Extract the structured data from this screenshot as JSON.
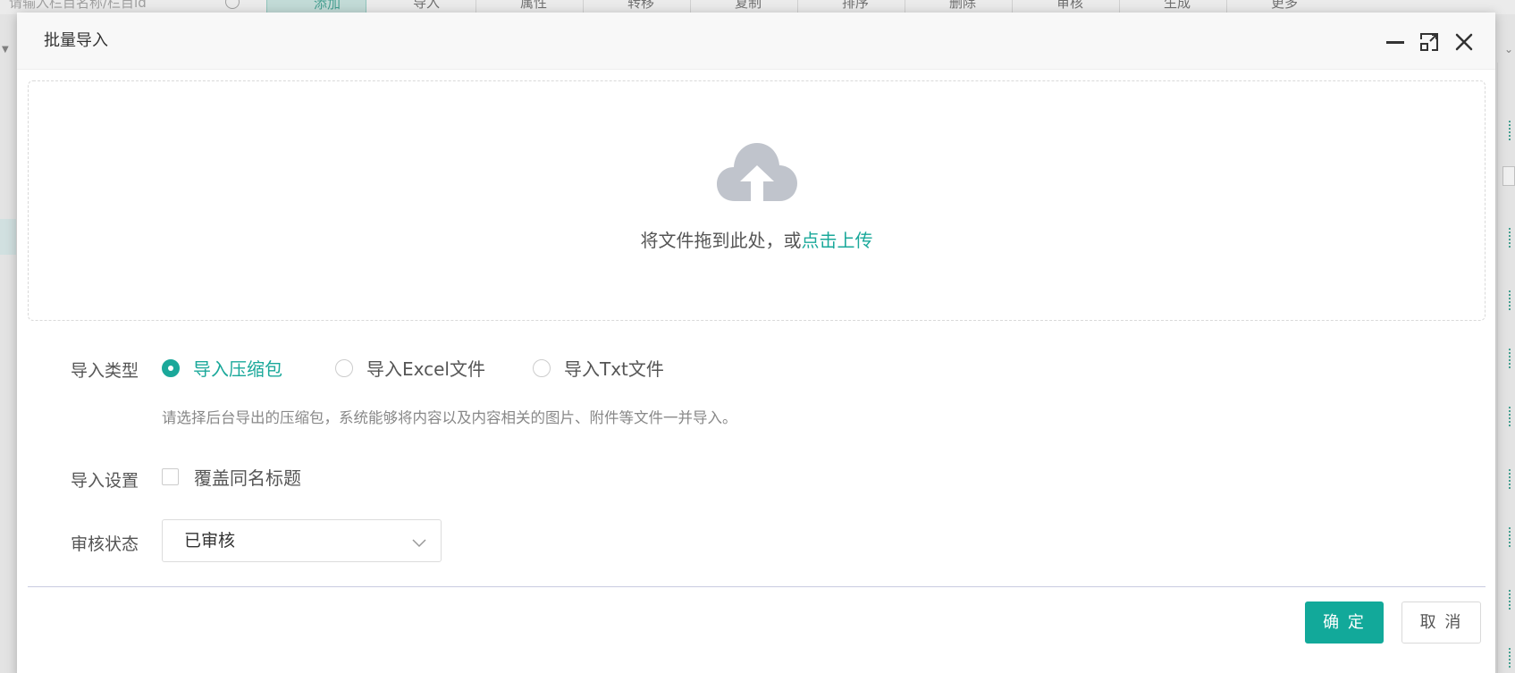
{
  "background": {
    "search_placeholder": "请输入栏目名称/栏目id",
    "toolbar": [
      {
        "label": "添加",
        "icon": "plus-circle-icon"
      },
      {
        "label": "导入",
        "icon": "chevron-down-icon"
      },
      {
        "label": "属性",
        "icon": "star-icon"
      },
      {
        "label": "转移",
        "icon": "arrow-right-icon"
      },
      {
        "label": "复制",
        "icon": "copy-icon"
      },
      {
        "label": "排序",
        "icon": "sort-icon"
      },
      {
        "label": "删除",
        "icon": "trash-icon"
      },
      {
        "label": "审核",
        "icon": "check-circle-icon"
      },
      {
        "label": "生成",
        "icon": "sparkle-icon"
      },
      {
        "label": "更多",
        "icon": "chevron-down-icon"
      }
    ]
  },
  "modal": {
    "title": "批量导入",
    "dropzone": {
      "text": "将文件拖到此处，或",
      "link": "点击上传"
    },
    "import_type": {
      "label": "导入类型",
      "options": [
        {
          "label": "导入压缩包",
          "checked": true
        },
        {
          "label": "导入Excel文件",
          "checked": false
        },
        {
          "label": "导入Txt文件",
          "checked": false
        }
      ],
      "hint": "请选择后台导出的压缩包，系统能够将内容以及内容相关的图片、附件等文件一并导入。"
    },
    "import_settings": {
      "label": "导入设置",
      "checkbox_label": "覆盖同名标题",
      "checked": false
    },
    "review_status": {
      "label": "审核状态",
      "value": "已审核"
    },
    "buttons": {
      "ok": "确 定",
      "cancel": "取 消"
    }
  },
  "colors": {
    "accent": "#12a99a",
    "link": "#1aa89a",
    "cloud": "#c0c4cc"
  }
}
